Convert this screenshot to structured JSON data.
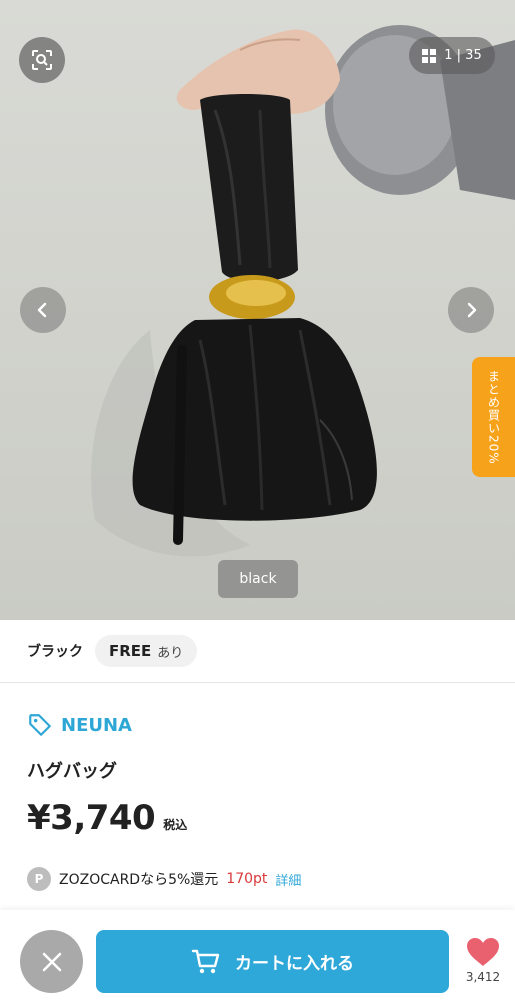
{
  "hero": {
    "image_counter": "1 | 35",
    "bulk_discount_label": "まとめ買い20%",
    "color_chip": "black"
  },
  "variant": {
    "color_label": "ブラック",
    "size": "FREE",
    "stock": "あり"
  },
  "product": {
    "brand": "NEUNA",
    "title": "ハグバッグ",
    "price": "¥3,740",
    "tax_label": "税込"
  },
  "points": {
    "badge": "P",
    "text": "ZOZOCARDなら5%還元",
    "pt": "170pt",
    "detail": "詳細"
  },
  "bottom": {
    "cart_label": "カートに入れる",
    "fav_count": "3,412"
  },
  "colors": {
    "accent": "#2ea7d9",
    "bulk_tab": "#f7a21b",
    "points_red": "#d83a3a",
    "heart": "#e9616f"
  },
  "icons": [
    "lens-search-icon",
    "grid-icon",
    "chevron-left-icon",
    "chevron-right-icon",
    "tag-icon",
    "close-icon",
    "cart-icon",
    "heart-icon"
  ]
}
